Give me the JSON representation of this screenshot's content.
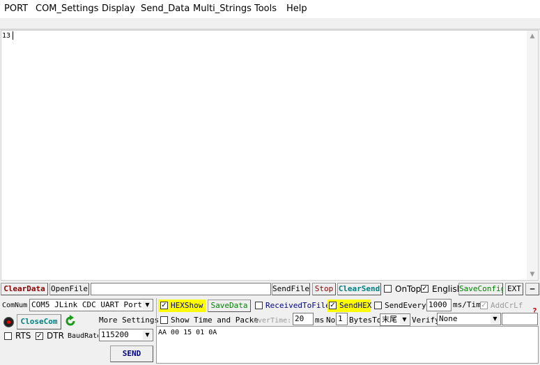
{
  "menu": [
    "PORT",
    "COM_Settings",
    "Display",
    "Send_Data",
    "Multi_Strings",
    "Tools",
    "Help"
  ],
  "receive": {
    "text": "13"
  },
  "toolbar": {
    "clear_data": "ClearData",
    "open_file": "OpenFile",
    "file_path": "",
    "send_file": "SendFile",
    "stop": "Stop",
    "clear_send": "ClearSend",
    "on_top": "OnTop",
    "english": "English",
    "save_config": "SaveConfig",
    "ext": "EXT",
    "minus": "—"
  },
  "port": {
    "com_num_label": "ComNum",
    "com_num_value": "COM5 JLink CDC UART Port",
    "close_com": "CloseCom",
    "more_settings": "More Settings",
    "rts": "RTS",
    "dtr": "DTR",
    "baud_label": "BaudRate",
    "baud_value": "115200",
    "send": "SEND"
  },
  "options": {
    "hex_show": "HEXShow",
    "save_data": "SaveData",
    "received_to_file": "ReceivedToFile",
    "send_hex": "SendHEX",
    "send_every": "SendEvery:",
    "interval_value": "1000",
    "interval_unit": "ms/Tim",
    "add_crlf": "AddCrLf",
    "show_time": "Show Time and Packe",
    "overtime_label": "OverTime:",
    "overtime_value": "20",
    "ms_label": "ms",
    "no_label": "No",
    "bytes_value": "1",
    "bytes_to_label": "BytesTo",
    "tail_value": "末尾",
    "verify_label": "Verify",
    "verify_value": "None",
    "question": "?"
  },
  "send_text": "AA 00 15 01 0A",
  "colors": {
    "red_text": "#8b0000",
    "green_text": "#008000",
    "blue_text": "#000080",
    "highlight": "#ffff00"
  }
}
